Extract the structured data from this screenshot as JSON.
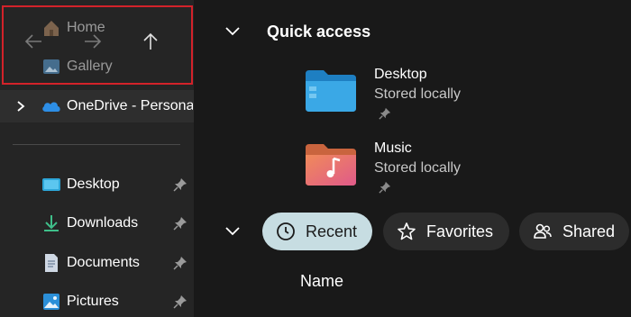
{
  "sidebar": {
    "home_label": "Home",
    "gallery_label": "Gallery",
    "onedrive_label": "OneDrive - Persona",
    "items": [
      {
        "label": "Desktop",
        "icon": "desktop-icon"
      },
      {
        "label": "Downloads",
        "icon": "download-icon"
      },
      {
        "label": "Documents",
        "icon": "document-icon"
      },
      {
        "label": "Pictures",
        "icon": "pictures-icon"
      }
    ]
  },
  "main": {
    "quick_access_title": "Quick access",
    "quick_access_items": [
      {
        "name": "Desktop",
        "status": "Stored locally",
        "icon": "desktop-folder-icon"
      },
      {
        "name": "Music",
        "status": "Stored locally",
        "icon": "music-folder-icon"
      }
    ],
    "filters": [
      {
        "label": "Recent",
        "icon": "clock-icon",
        "active": true
      },
      {
        "label": "Favorites",
        "icon": "star-icon",
        "active": false
      },
      {
        "label": "Shared",
        "icon": "people-icon",
        "active": false
      }
    ],
    "column_header": "Name"
  },
  "colors": {
    "highlight": "#d3222a",
    "active_pill": "#c7dde2",
    "pill": "#2c2c2c",
    "folder_blue": "#3aa0dc",
    "folder_music": "#e8716b"
  }
}
